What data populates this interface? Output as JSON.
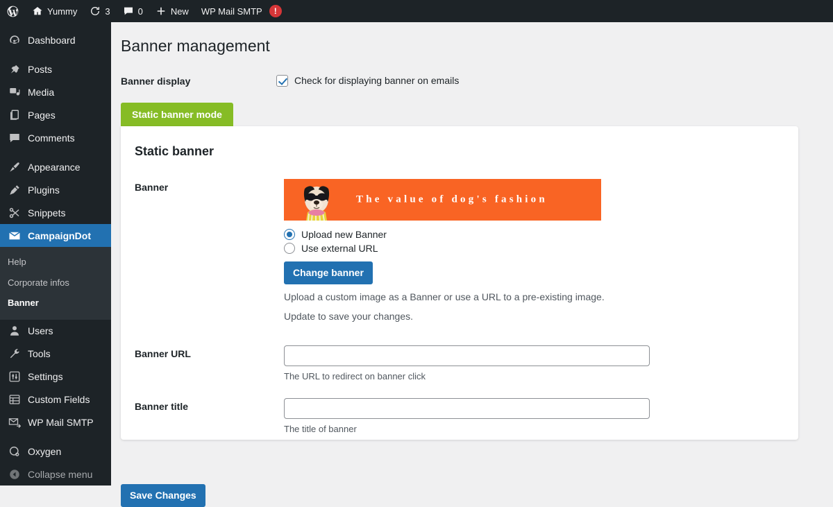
{
  "adminbar": {
    "items": [
      {
        "icon": "wordpress-logo-icon",
        "label": ""
      },
      {
        "icon": "home-icon",
        "label": "Yummy"
      },
      {
        "icon": "updates-icon",
        "label": "3"
      },
      {
        "icon": "comment-bubble-icon",
        "label": "0"
      },
      {
        "icon": "plus-icon",
        "label": "New"
      },
      {
        "icon": "",
        "label": "WP Mail SMTP"
      }
    ],
    "alert_badge": "!"
  },
  "sidebar": {
    "items": [
      {
        "label": "Dashboard",
        "icon": "dashboard-icon",
        "state": "normal"
      },
      {
        "label": "Posts",
        "icon": "pin-icon",
        "state": "normal"
      },
      {
        "label": "Media",
        "icon": "media-icon",
        "state": "normal"
      },
      {
        "label": "Pages",
        "icon": "pages-icon",
        "state": "normal"
      },
      {
        "label": "Comments",
        "icon": "comment-bubble-icon",
        "state": "normal"
      },
      {
        "label": "Appearance",
        "icon": "paintbrush-icon",
        "state": "normal"
      },
      {
        "label": "Plugins",
        "icon": "plug-icon",
        "state": "normal"
      },
      {
        "label": "Snippets",
        "icon": "scissors-icon",
        "state": "normal"
      },
      {
        "label": "CampaignDot",
        "icon": "envelope-icon",
        "state": "current"
      },
      {
        "label": "Users",
        "icon": "user-icon",
        "state": "normal"
      },
      {
        "label": "Tools",
        "icon": "wrench-icon",
        "state": "normal"
      },
      {
        "label": "Settings",
        "icon": "sliders-icon",
        "state": "normal"
      },
      {
        "label": "Custom Fields",
        "icon": "table-icon",
        "state": "normal"
      },
      {
        "label": "WP Mail SMTP",
        "icon": "mail-send-icon",
        "state": "normal"
      },
      {
        "label": "Oxygen",
        "icon": "oxygen-icon",
        "state": "normal"
      },
      {
        "label": "Collapse menu",
        "icon": "collapse-arrow-icon",
        "state": "dim"
      }
    ],
    "submenu": [
      {
        "label": "Help",
        "current": false
      },
      {
        "label": "Corporate infos",
        "current": false
      },
      {
        "label": "Banner",
        "current": true
      }
    ]
  },
  "page": {
    "title": "Banner management",
    "banner_display_label": "Banner display",
    "checkbox_label": "Check for displaying banner on emails",
    "checkbox_checked": true,
    "tab_label": "Static banner mode",
    "card_title": "Static banner"
  },
  "banner_field": {
    "label": "Banner",
    "preview_text": "The value of dog's fashion",
    "preview_bg": "#f96424",
    "radio_options": [
      {
        "label": "Upload new Banner",
        "selected": true
      },
      {
        "label": "Use external URL",
        "selected": false
      }
    ],
    "change_button": "Change banner",
    "help_line1": "Upload a custom image as a Banner or use a URL to a pre-existing image.",
    "help_line2": "Update to save your changes."
  },
  "banner_url_field": {
    "label": "Banner URL",
    "value": "",
    "placeholder": "",
    "help": "The URL to redirect on banner click"
  },
  "banner_title_field": {
    "label": "Banner title",
    "value": "",
    "placeholder": "",
    "help": "The title of banner"
  },
  "footer": {
    "save_label": "Save Changes"
  },
  "colors": {
    "accent_blue": "#2271b1",
    "tab_green": "#86bc25",
    "banner_orange": "#f96424",
    "alert_red": "#d63638",
    "sidebar_dark": "#1d2327"
  }
}
